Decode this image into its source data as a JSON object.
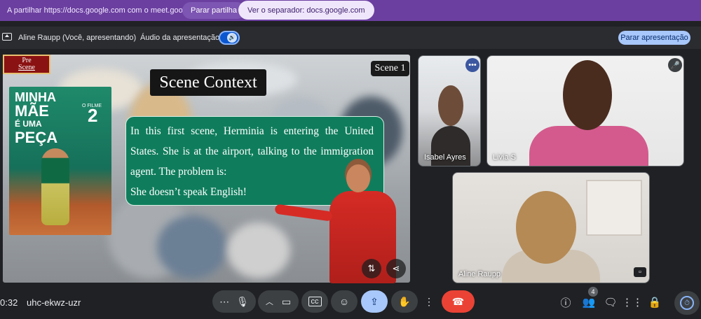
{
  "share_banner": {
    "text": "A partilhar https://docs.google.com com o meet.google.com...",
    "stop_label": "Parar partilha",
    "view_tab_label": "Ver o separador: docs.google.com"
  },
  "present_bar": {
    "presenter": "Aline Raupp (Você, apresentando)",
    "audio_label": "Áudio da apresentação",
    "stop_label": "Parar apresentação"
  },
  "slide": {
    "prescene_line1": "Pre",
    "prescene_line2": "Scene",
    "scene_tag": "Scene 1",
    "title": "Scene Context",
    "poster_title_1": "MINHA",
    "poster_title_2": "MÃE",
    "poster_title_3": "É UMA",
    "poster_title_4": "PEÇA",
    "poster_small": "O FILME",
    "poster_num": "2",
    "paragraph": "In this first scene, Herminia is entering the United States. She is at the airport, talking to the immigration agent. The problem is:",
    "last_line": "She doesn’t speak English!"
  },
  "participants": [
    {
      "name": "Isabel Ayres"
    },
    {
      "name": "Livia S"
    },
    {
      "name": "Aline Raupp"
    }
  ],
  "meeting": {
    "time": "0:32",
    "code": "uhc-ekwz-uzr",
    "people_count": "4"
  },
  "colors": {
    "banner": "#6b3fa0",
    "accent": "#8ab4f8",
    "end_call": "#ea4335",
    "slide_box": "#0f7d5c"
  }
}
